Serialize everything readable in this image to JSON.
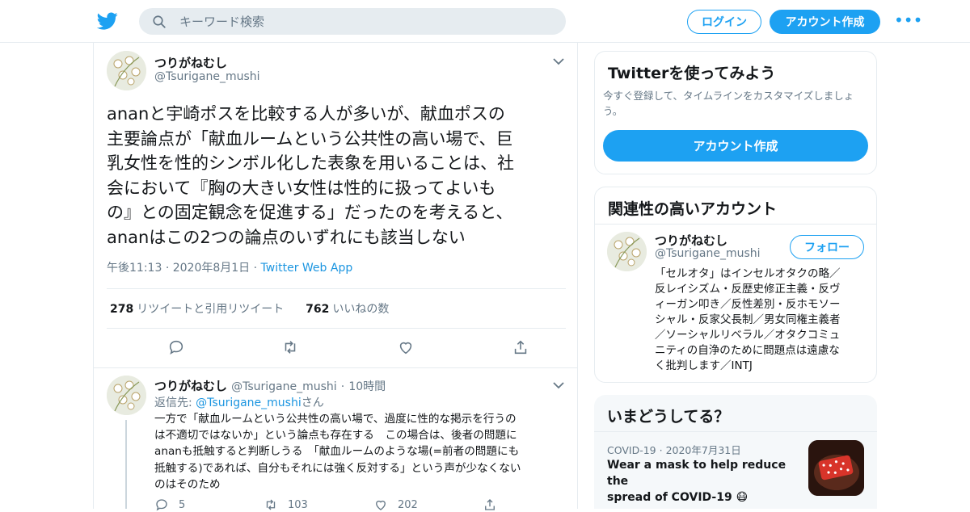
{
  "header": {
    "search_placeholder": "キーワード検索",
    "login_label": "ログイン",
    "signup_label": "アカウント作成",
    "more_label": "•••"
  },
  "tweet": {
    "author_name": "つりがねむし",
    "author_handle": "@Tsurigane_mushi",
    "lines": [
      "ananと宇崎ポスを比較する人が多いが、献血ポスの",
      "主要論点が「献血ルームという公共性の高い場で、巨",
      "乳女性を性的シンボル化した表象を用いることは、社",
      "会において『胸の大きい女性は性的に扱ってよいも",
      "の』との固定観念を促進する」だったのを考えると、",
      "ananはこの2つの論点のいずれにも該当しない"
    ],
    "time": "午後11:13",
    "date": "2020年8月1日",
    "source": "Twitter Web App",
    "retweets_count": "278",
    "retweets_label": "リツイートと引用リツイート",
    "likes_count": "762",
    "likes_label": "いいねの数"
  },
  "reply": {
    "author_name": "つりがねむし",
    "author_handle": "@Tsurigane_mushi",
    "time_ago": "10時間",
    "reply_to_prefix": "返信先: ",
    "reply_to_handle": "@Tsurigane_mushi",
    "reply_to_suffix": "さん",
    "lines": [
      "一方で「献血ルームという公共性の高い場で、過度に性的な掲示を行うの",
      "は不適切ではないか」という論点も存在する　この場合は、後者の問題に",
      "ananも抵触すると判断しうる　「献血ルームのような場(=前者の問題にも",
      "抵触する)であれば、自分もそれには強く反対する」という声が少なくない",
      "のはそのため"
    ],
    "reply_count": "5",
    "retweet_count": "103",
    "like_count": "202"
  },
  "sidebar": {
    "try_card": {
      "title": "Twitterを使ってみよう",
      "desc_line1": "今すぐ登録して、タイムラインをカスタマイズしましょ",
      "desc_line2": "う。",
      "button": "アカウント作成"
    },
    "related": {
      "title": "関連性の高いアカウント",
      "name": "つりがねむし",
      "handle": "@Tsurigane_mushi",
      "follow_label": "フォロー",
      "bio_lines": [
        "「セルオタ」はインセルオタクの略／",
        "反レイシズム・反歴史修正主義・反ヴ",
        "ィーガン叩き／反性差別・反ホモソー",
        "シャル・反家父長制／男女同権主義者",
        "／ソーシャルリベラル／オタクコミュ",
        "ニティの自浄のために問題点は遠慮な",
        "く批判します／INTJ"
      ]
    },
    "trends": {
      "title": "いまどうしてる？",
      "topic": "COVID-19",
      "date": "2020年7月31日",
      "headline_line1": "Wear a mask to help reduce the",
      "headline_line2": "spread of COVID-19 😷"
    }
  },
  "colors": {
    "brand": "#1da1f2",
    "text": "#14171a",
    "muted": "#657786",
    "border": "#e6ecf0"
  },
  "icons": [
    "twitter-bird-icon",
    "search-icon",
    "chevron-down-icon",
    "reply-icon",
    "retweet-icon",
    "like-icon",
    "share-icon"
  ]
}
